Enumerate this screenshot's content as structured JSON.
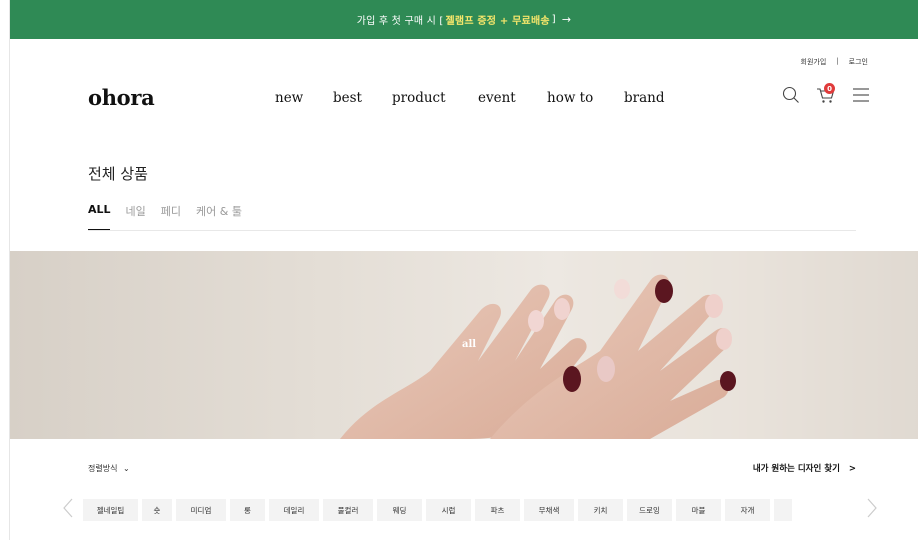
{
  "promo": {
    "prefix": "가입 후 첫 구매 시 [",
    "highlight": "젤램프 증정 + 무료배송",
    "suffix": "]",
    "arrow": "→"
  },
  "util_links": {
    "signup": "회원가입",
    "separator": "|",
    "login": "로그인"
  },
  "brand": {
    "logo": "ohora"
  },
  "nav": [
    "new",
    "best",
    "product",
    "event",
    "how to",
    "brand"
  ],
  "cart": {
    "count": "0"
  },
  "page_title": "전체 상품",
  "category_tabs": [
    "ALL",
    "네일",
    "페디",
    "케어 & 툴"
  ],
  "hero": {
    "label": "all"
  },
  "sort": {
    "label": "정렬방식",
    "caret": "⌄"
  },
  "design_finder": {
    "label": "내가 원하는 디자인 찾기",
    "chevron": ">"
  },
  "chips": [
    "젤네일팁",
    "숏",
    "미디엄",
    "롱",
    "데일리",
    "풀컬러",
    "웨딩",
    "시럽",
    "파츠",
    "무채색",
    "키치",
    "드로잉",
    "마블",
    "자개"
  ],
  "colors": {
    "promo_bg": "#2f8a55",
    "promo_highlight": "#f5e66b"
  }
}
